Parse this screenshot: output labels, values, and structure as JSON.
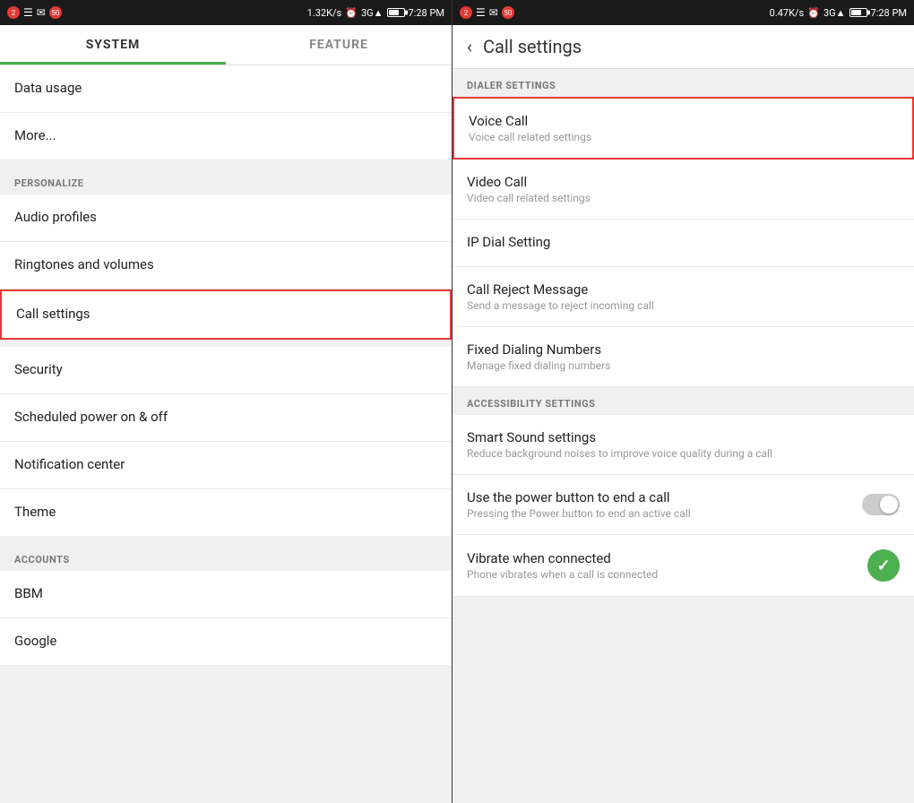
{
  "left_panel": {
    "status_bar": {
      "network_speed": "1.32K/s",
      "time": "7:28 PM",
      "battery_label": "50"
    },
    "tabs": [
      {
        "id": "system",
        "label": "SYSTEM",
        "active": true
      },
      {
        "id": "feature",
        "label": "FEATURE",
        "active": false
      }
    ],
    "sections": [
      {
        "id": "top-group",
        "label": null,
        "items": [
          {
            "id": "data-usage",
            "title": "Data usage",
            "subtitle": null,
            "highlighted": false
          },
          {
            "id": "more",
            "title": "More...",
            "subtitle": null,
            "highlighted": false
          }
        ]
      },
      {
        "id": "personalize",
        "label": "PERSONALIZE",
        "items": [
          {
            "id": "audio-profiles",
            "title": "Audio profiles",
            "subtitle": null,
            "highlighted": false
          },
          {
            "id": "ringtones-volumes",
            "title": "Ringtones and volumes",
            "subtitle": null,
            "highlighted": false
          },
          {
            "id": "call-settings",
            "title": "Call settings",
            "subtitle": null,
            "highlighted": true
          }
        ]
      },
      {
        "id": "second-group",
        "label": null,
        "items": [
          {
            "id": "security",
            "title": "Security",
            "subtitle": null,
            "highlighted": false
          },
          {
            "id": "scheduled-power",
            "title": "Scheduled power on & off",
            "subtitle": null,
            "highlighted": false
          },
          {
            "id": "notification-center",
            "title": "Notification center",
            "subtitle": null,
            "highlighted": false
          },
          {
            "id": "theme",
            "title": "Theme",
            "subtitle": null,
            "highlighted": false
          }
        ]
      },
      {
        "id": "accounts",
        "label": "ACCOUNTS",
        "items": [
          {
            "id": "bbm",
            "title": "BBM",
            "subtitle": null,
            "highlighted": false
          },
          {
            "id": "google",
            "title": "Google",
            "subtitle": null,
            "highlighted": false
          }
        ]
      }
    ]
  },
  "right_panel": {
    "status_bar": {
      "network_speed": "0.47K/s",
      "time": "7:28 PM",
      "battery_label": "50"
    },
    "header": {
      "back_label": "‹",
      "title": "Call settings"
    },
    "sections": [
      {
        "id": "dialer-settings",
        "label": "DIALER SETTINGS",
        "items": [
          {
            "id": "voice-call",
            "title": "Voice Call",
            "subtitle": "Voice call related settings",
            "highlighted": true,
            "control": null
          },
          {
            "id": "video-call",
            "title": "Video Call",
            "subtitle": "Video call related settings",
            "highlighted": false,
            "control": null
          },
          {
            "id": "ip-dial",
            "title": "IP Dial Setting",
            "subtitle": null,
            "highlighted": false,
            "control": null
          },
          {
            "id": "call-reject-msg",
            "title": "Call Reject Message",
            "subtitle": "Send a message to reject incoming call",
            "highlighted": false,
            "control": null
          },
          {
            "id": "fixed-dialing",
            "title": "Fixed Dialing Numbers",
            "subtitle": "Manage fixed dialing numbers",
            "highlighted": false,
            "control": null
          }
        ]
      },
      {
        "id": "accessibility-settings",
        "label": "ACCESSIBILITY SETTINGS",
        "items": [
          {
            "id": "smart-sound",
            "title": "Smart Sound settings",
            "subtitle": "Reduce background noises to improve voice quality during a call",
            "highlighted": false,
            "control": null
          },
          {
            "id": "power-button-end",
            "title": "Use the power button to end a call",
            "subtitle": "Pressing the Power button to end an active call",
            "highlighted": false,
            "control": "toggle-off"
          },
          {
            "id": "vibrate-connected",
            "title": "Vibrate when connected",
            "subtitle": "Phone vibrates when a call is connected",
            "highlighted": false,
            "control": "checkmark"
          }
        ]
      }
    ]
  }
}
